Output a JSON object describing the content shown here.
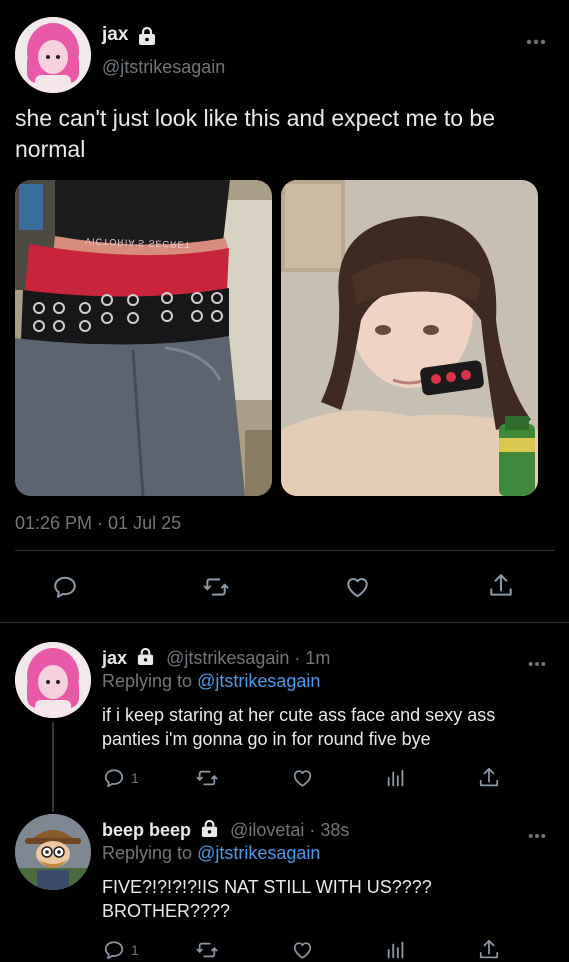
{
  "main_tweet": {
    "display_name": "jax",
    "handle": "@jtstrikesagain",
    "text": "she can't just look like this and expect me to be normal",
    "photo_left_text": "VICTORIA'S SECRET",
    "timestamp": "01:26 PM · 01 Jul 25",
    "actions": [
      "reply-icon",
      "retweet-icon",
      "like-icon",
      "share-icon"
    ]
  },
  "replies": [
    {
      "display_name": "jax",
      "handle": "@jtstrikesagain",
      "time": "1m",
      "meta_sep": "·",
      "replying_prefix": "Replying to",
      "replying_to": "@jtstrikesagain",
      "text": "if i keep staring at her cute ass face and sexy ass panties i'm gonna go in for round five bye",
      "reply_count": "1"
    },
    {
      "display_name": "beep beep",
      "handle": "@ilovetai",
      "time": "38s",
      "meta_sep": "·",
      "replying_prefix": "Replying to",
      "replying_to": "@jtstrikesagain",
      "text": "FIVE?!?!?!?!IS NAT STILL WITH US???? BROTHER????",
      "reply_count": "1"
    }
  ],
  "colors": {
    "background": "#000000",
    "text": "#e7e9ea",
    "secondary": "#71767b",
    "link": "#4a9ce9",
    "divider": "#2f3336"
  }
}
